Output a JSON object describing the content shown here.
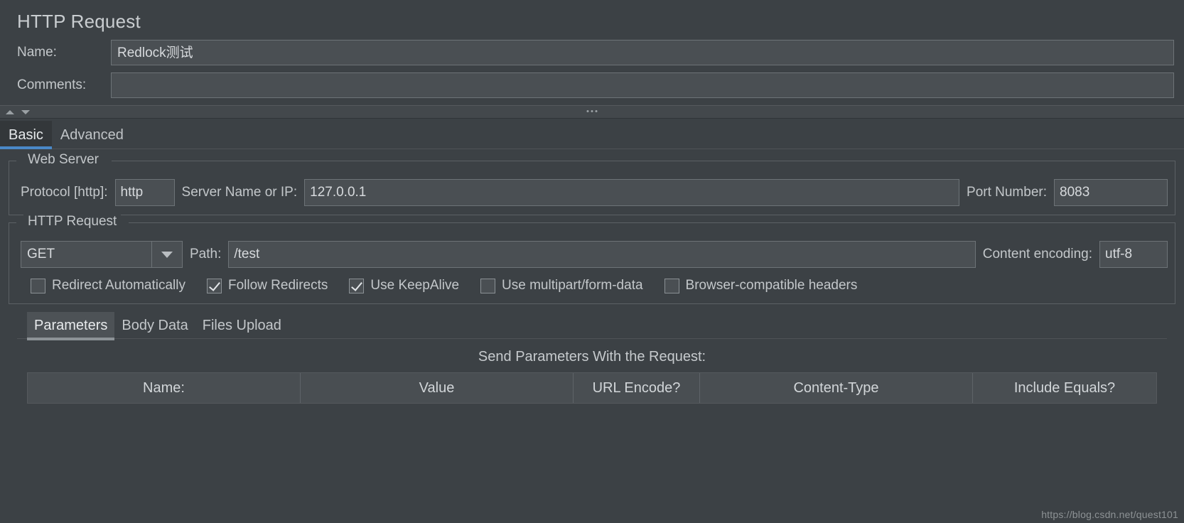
{
  "header": {
    "title": "HTTP Request",
    "name_label": "Name:",
    "name_value": "Redlock测试",
    "comments_label": "Comments:",
    "comments_value": "",
    "comments_placeholder": ""
  },
  "splitter": {
    "collapse_up_icon": "triangle-up-icon",
    "collapse_down_icon": "triangle-down-icon",
    "grip_icon": "dots-grip-icon"
  },
  "tabs": [
    {
      "label": "Basic",
      "active": true
    },
    {
      "label": "Advanced",
      "active": false
    }
  ],
  "web_server": {
    "legend": "Web Server",
    "protocol_label": "Protocol [http]:",
    "protocol_value": "http",
    "server_label": "Server Name or IP:",
    "server_value": "127.0.0.1",
    "port_label": "Port Number:",
    "port_value": "8083"
  },
  "http_request": {
    "legend": "HTTP Request",
    "method_value": "GET",
    "method_arrow_icon": "chevron-down-icon",
    "path_label": "Path:",
    "path_value": "/test",
    "encoding_label": "Content encoding:",
    "encoding_value": "utf-8",
    "options": [
      {
        "label": "Redirect Automatically",
        "checked": false
      },
      {
        "label": "Follow Redirects",
        "checked": true
      },
      {
        "label": "Use KeepAlive",
        "checked": true
      },
      {
        "label": "Use multipart/form-data",
        "checked": false
      },
      {
        "label": "Browser-compatible headers",
        "checked": false
      }
    ]
  },
  "sub_tabs": [
    {
      "label": "Parameters",
      "active": true
    },
    {
      "label": "Body Data",
      "active": false
    },
    {
      "label": "Files Upload",
      "active": false
    }
  ],
  "parameters": {
    "caption": "Send Parameters With the Request:",
    "columns": [
      "Name:",
      "Value",
      "URL Encode?",
      "Content-Type",
      "Include Equals?"
    ],
    "rows": []
  },
  "watermark": "https://blog.csdn.net/quest101",
  "colors": {
    "background": "#3c4145",
    "accent": "#4a88c7",
    "field_bg": "#4a4f53",
    "border": "#6d7377",
    "text": "#c3c7ca"
  }
}
